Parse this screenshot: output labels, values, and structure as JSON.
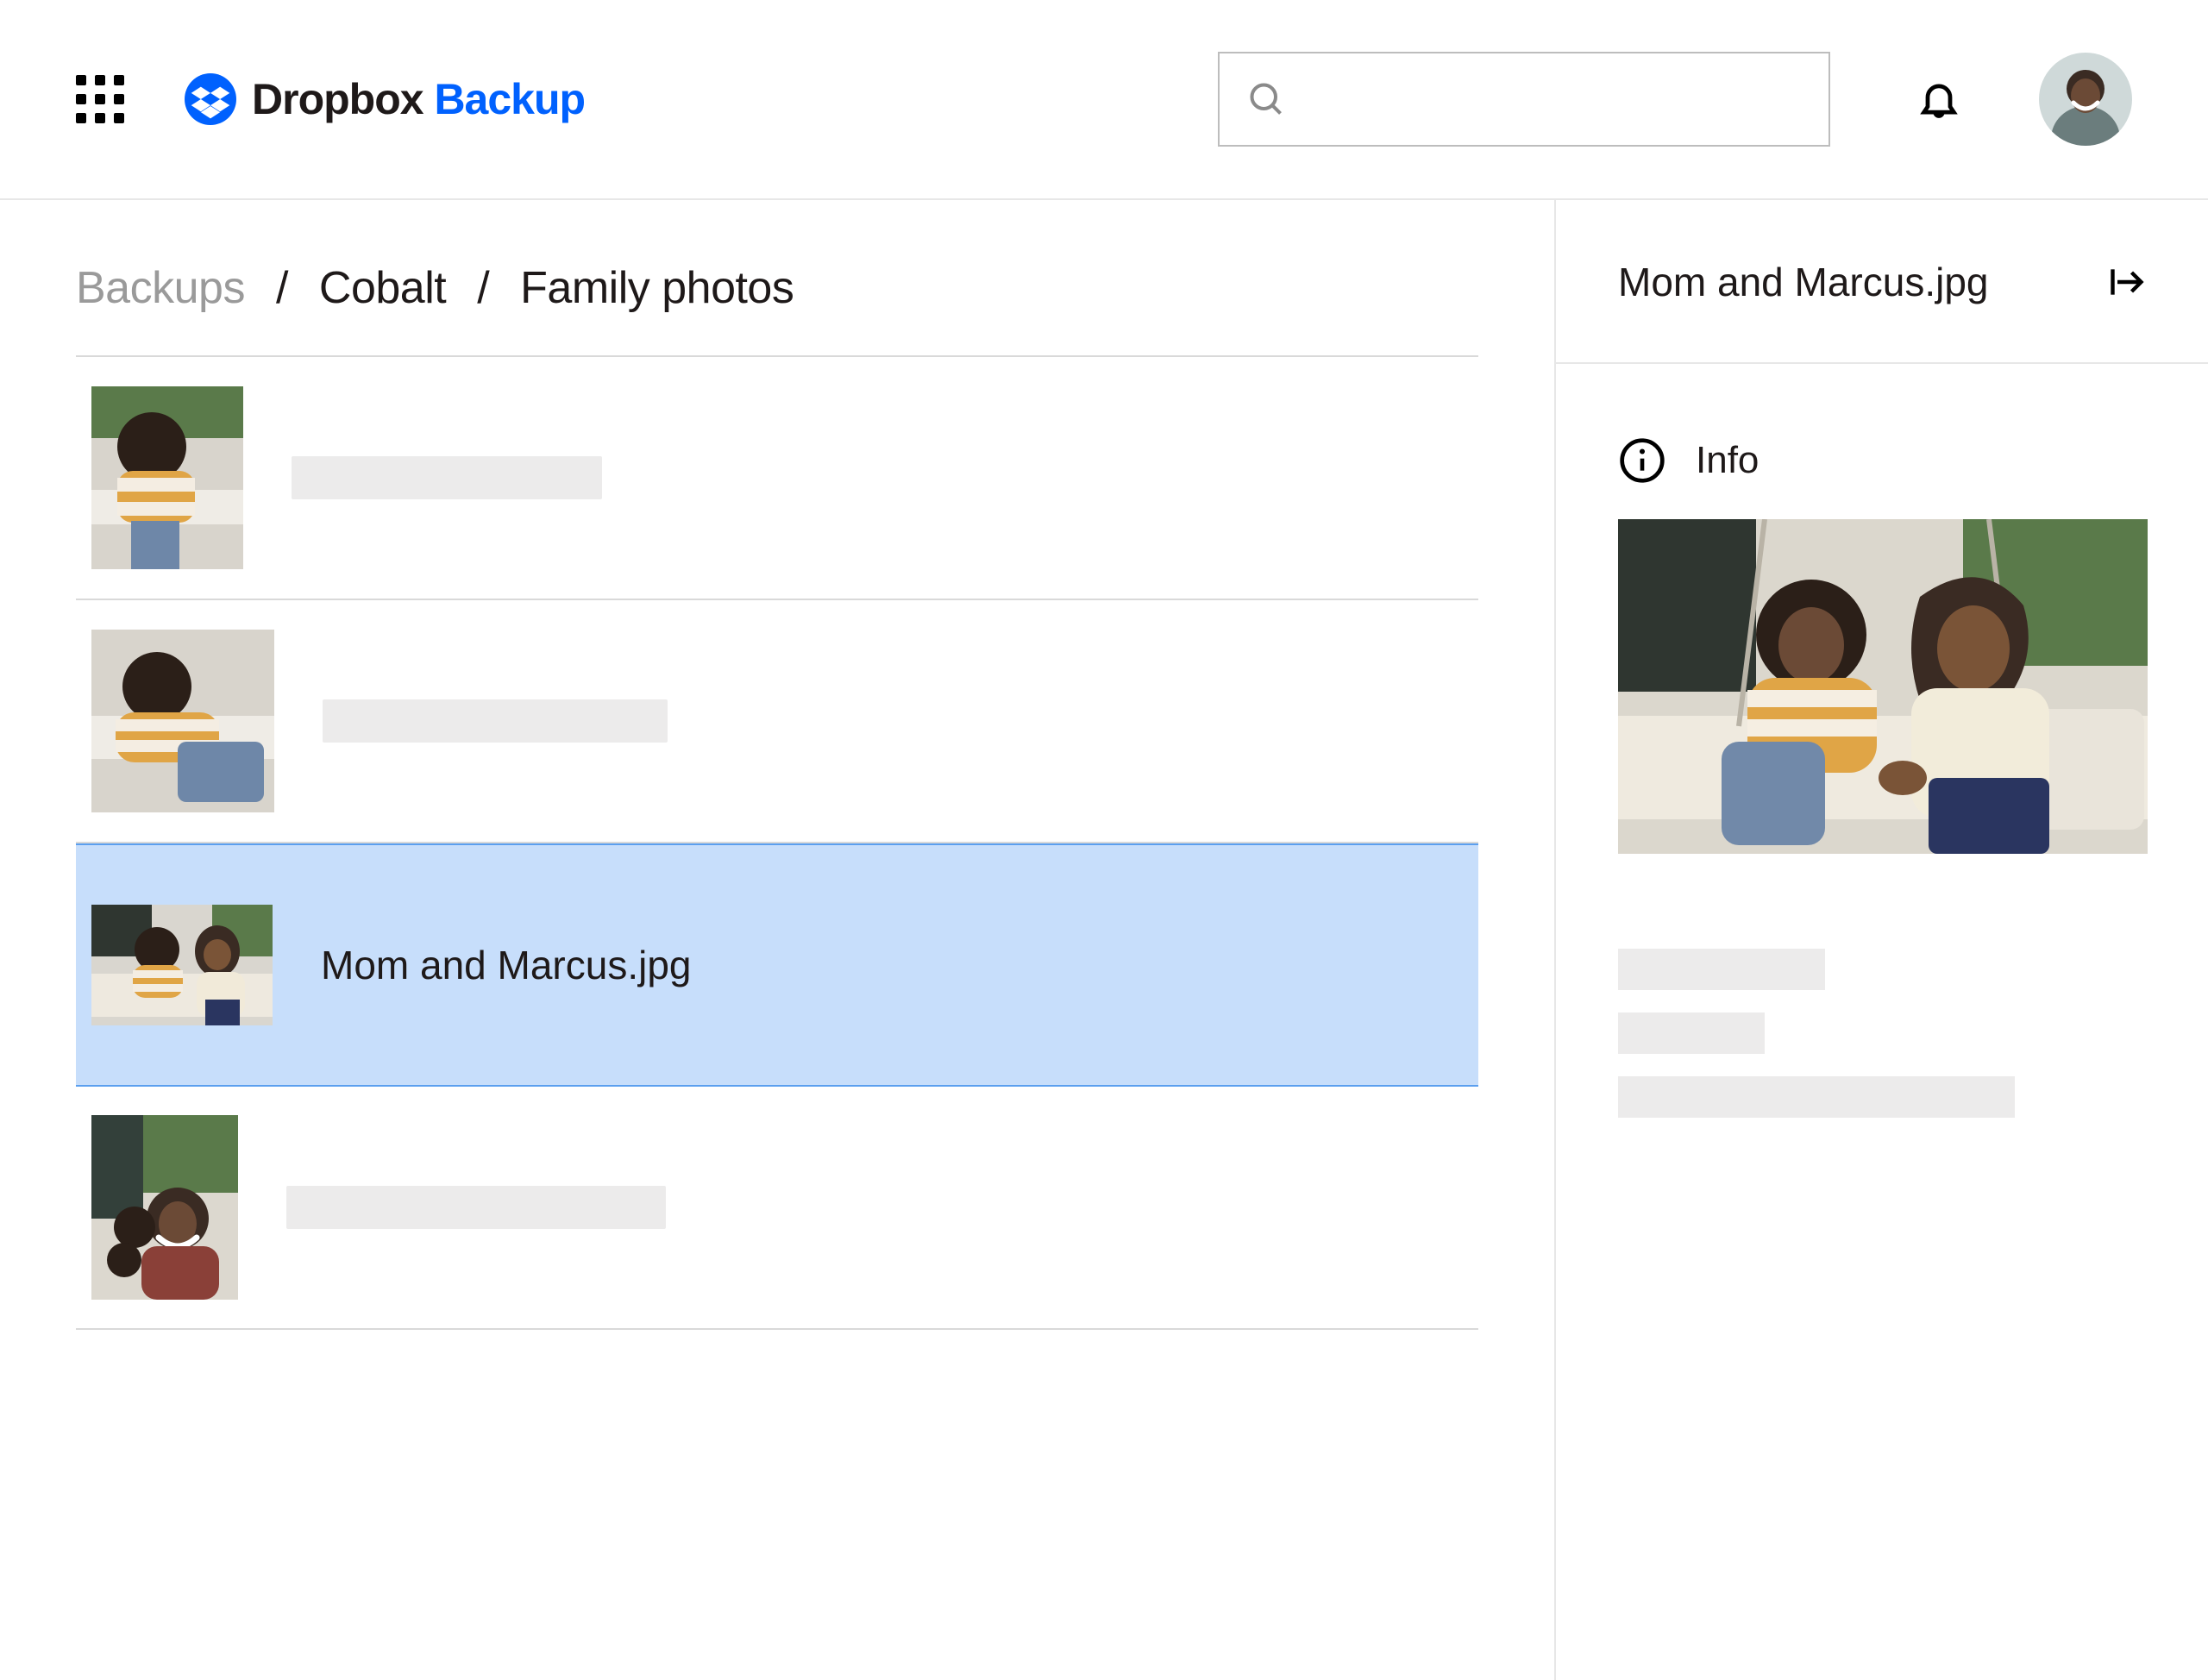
{
  "brand": {
    "name": "Dropbox",
    "sub": "Backup"
  },
  "search": {
    "placeholder": ""
  },
  "breadcrumb": {
    "root": "Backups",
    "sep": "/",
    "mid": "Cobalt",
    "leaf": "Family photos"
  },
  "files": [
    {
      "name": "",
      "selected": false
    },
    {
      "name": "",
      "selected": false
    },
    {
      "name": "Mom and Marcus.jpg",
      "selected": true
    },
    {
      "name": "",
      "selected": false
    }
  ],
  "side": {
    "title": "Mom and Marcus.jpg",
    "info_label": "Info"
  }
}
